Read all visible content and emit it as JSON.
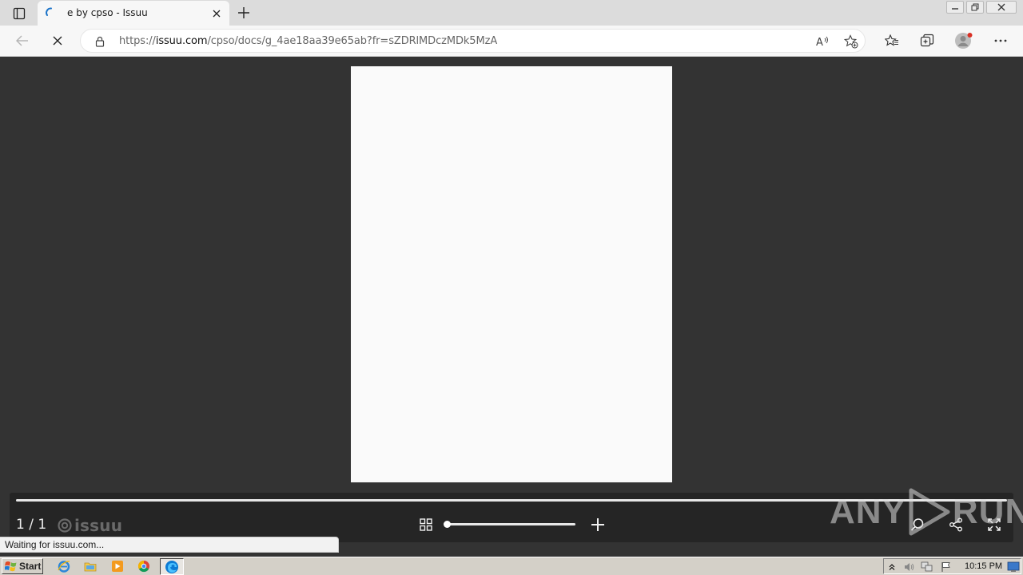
{
  "browser": {
    "tab": {
      "title": "e by cpso - Issuu",
      "loading": true
    },
    "address_bar": {
      "url_prefix": "https://",
      "url_host": "issuu.com",
      "url_path": "/cpso/docs/g_4ae18aa39e65ab?fr=sZDRlMDczMDk5MzA"
    },
    "icons": [
      "tab-actions-icon",
      "close-icon",
      "plus-icon",
      "back-arrow-icon",
      "stop-icon",
      "lock-icon",
      "read-aloud-icon",
      "add-favorite-icon",
      "favorites-icon",
      "collections-icon",
      "profile-icon",
      "more-icon"
    ],
    "status_text": "Waiting for issuu.com..."
  },
  "viewer": {
    "page_counter": "1 / 1",
    "logo_text": "issuu",
    "zoom_level": 0,
    "watermark_text": "ANY",
    "watermark_text2": "RUN"
  },
  "taskbar": {
    "start_label": "Start",
    "clock": "10:15 PM",
    "quick_launch": [
      "ie-icon",
      "folder-icon",
      "media-player-icon",
      "chrome-icon"
    ]
  },
  "colors": {
    "viewer_bg": "#333333",
    "control_bar_bg": "#252525",
    "edge_blue": "#0c7bd4"
  }
}
